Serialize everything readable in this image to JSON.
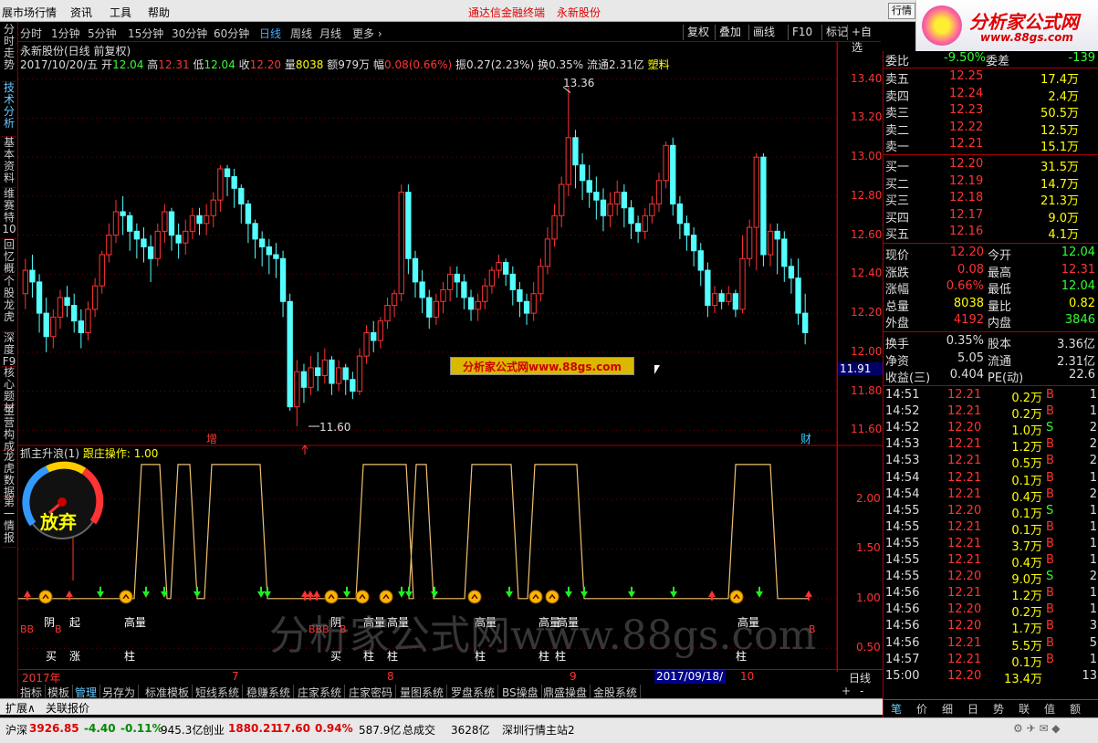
{
  "menubar": {
    "items": [
      "展市场行情",
      "资讯",
      "工具",
      "帮助"
    ],
    "center_left": "通达信金融终端",
    "center_right": "永新股份",
    "btn_hq": "行情"
  },
  "logo": {
    "title": "分析家公式网",
    "url": "www.88gs.com"
  },
  "periods": [
    "分时",
    "1分钟",
    "5分钟",
    "15分钟",
    "30分钟",
    "60分钟",
    "日线",
    "周线",
    "月线",
    "更多 ›"
  ],
  "period_active": "日线",
  "period_right": [
    "复权",
    "叠加",
    "画线",
    "F10",
    "标记",
    "+自选"
  ],
  "lefttabs": [
    "分时走势",
    "技术分析",
    "基本资料",
    "维赛特10",
    "回忆概",
    "个股龙虎",
    "深度F9",
    "核心题材",
    "主营构成",
    "龙虎数据",
    "第一情报"
  ],
  "info": {
    "name": "永新股份(日线 前复权)",
    "date": "2017/10/20/五",
    "open_l": "开",
    "open": "12.04",
    "high_l": "高",
    "high": "12.31",
    "low_l": "低",
    "low": "12.04",
    "close_l": "收",
    "close": "12.20",
    "vol_l": "量",
    "vol": "8038",
    "amt": "额979万",
    "chg_l": "幅",
    "chg": "0.08(0.66%)",
    "amp": "振0.27(2.23%)",
    "turn": "换0.35%",
    "float": "流通2.31亿",
    "ind": "塑料"
  },
  "axis": {
    "main_ticks": [
      "13.40",
      "13.20",
      "13.00",
      "12.80",
      "12.60",
      "12.40",
      "12.20",
      "12.00",
      "11.80",
      "11.60"
    ],
    "cur_price": "11.91",
    "ind_ticks": [
      "2.00",
      "1.50",
      "1.00",
      "0.50"
    ]
  },
  "annotations": {
    "high_label": "13.36",
    "low_label": "11.60",
    "zeng": "增",
    "cai": "财"
  },
  "indicator": {
    "title": "抓主升浪(1)",
    "op_label": "跟庄操作:",
    "op_value": "1.00",
    "gauge_text": "放弃"
  },
  "signals": {
    "row1": [
      "阴",
      "起",
      "高量",
      "阴",
      "高量",
      "高量",
      "高量",
      "高量",
      "高量",
      "高量",
      "高量"
    ],
    "row2": [
      "买",
      "涨",
      "柱",
      "买",
      "柱",
      "柱",
      "柱",
      "柱",
      "柱",
      "柱"
    ],
    "bb": [
      "BB",
      "B",
      "BBB",
      "B",
      "B"
    ]
  },
  "ad_text": "分析家公式网www.88gs.com",
  "watermark": "分析家公式网www.88gs.com",
  "dates": [
    "2017年",
    "7",
    "8",
    "9",
    "10"
  ],
  "date_cursor": "2017/09/18/—",
  "date_right": "日线",
  "bottomtabs": [
    "指标",
    "模板",
    "管理",
    "另存为",
    "标准模板",
    "短线系统",
    "稳赚系统",
    "庄家系统",
    "庄家密码",
    "量图系统",
    "罗盘系统",
    "BS操盘",
    "鼎盛操盘",
    "金股系统"
  ],
  "bottomtabs_active": "管理",
  "ext": {
    "a": "扩展∧",
    "b": "关联报价"
  },
  "status": {
    "sh_label": "沪深",
    "sh": "3926.85",
    "sh_chg": "-4.40",
    "sh_pct": "-0.11%",
    "sh_amt": "945.3亿",
    "cy_label": "创业",
    "cy": "1880.21",
    "cy_chg": "17.60",
    "cy_pct": "0.94%",
    "cy_amt": "587.9亿",
    "total_label": "总成交",
    "total": "3628亿",
    "station": "深圳行情主站2"
  },
  "quote": {
    "weibi": {
      "l": "委比",
      "v": "-9.50%",
      "l2": "委差",
      "v2": "-139"
    },
    "sells": [
      {
        "l": "卖五",
        "p": "12.25",
        "v": "17.4万"
      },
      {
        "l": "卖四",
        "p": "12.24",
        "v": "2.4万"
      },
      {
        "l": "卖三",
        "p": "12.23",
        "v": "50.5万"
      },
      {
        "l": "卖二",
        "p": "12.22",
        "v": "12.5万"
      },
      {
        "l": "卖一",
        "p": "12.21",
        "v": "15.1万"
      }
    ],
    "buys": [
      {
        "l": "买一",
        "p": "12.20",
        "v": "31.5万"
      },
      {
        "l": "买二",
        "p": "12.19",
        "v": "14.7万"
      },
      {
        "l": "买三",
        "p": "12.18",
        "v": "21.3万"
      },
      {
        "l": "买四",
        "p": "12.17",
        "v": "9.0万"
      },
      {
        "l": "买五",
        "p": "12.16",
        "v": "4.1万"
      }
    ],
    "stats": [
      {
        "l": "现价",
        "v": "12.20",
        "l2": "今开",
        "v2": "12.04"
      },
      {
        "l": "涨跌",
        "v": "0.08",
        "l2": "最高",
        "v2": "12.31"
      },
      {
        "l": "涨幅",
        "v": "0.66%",
        "l2": "最低",
        "v2": "12.04"
      },
      {
        "l": "总量",
        "v": "8038",
        "l2": "量比",
        "v2": "0.82"
      },
      {
        "l": "外盘",
        "v": "4192",
        "l2": "内盘",
        "v2": "3846"
      }
    ],
    "stats2": [
      {
        "l": "换手",
        "v": "0.35%",
        "l2": "股本",
        "v2": "3.36亿"
      },
      {
        "l": "净资",
        "v": "5.05",
        "l2": "流通",
        "v2": "2.31亿"
      },
      {
        "l": "收益(三)",
        "v": "0.404",
        "l2": "PE(动)",
        "v2": "22.6"
      }
    ],
    "ticks": [
      {
        "t": "14:51",
        "p": "12.21",
        "v": "0.2万",
        "bs": "B",
        "n": "1"
      },
      {
        "t": "14:52",
        "p": "12.21",
        "v": "0.2万",
        "bs": "B",
        "n": "1"
      },
      {
        "t": "14:52",
        "p": "12.20",
        "v": "1.0万",
        "bs": "S",
        "n": "2"
      },
      {
        "t": "14:53",
        "p": "12.21",
        "v": "1.2万",
        "bs": "B",
        "n": "2"
      },
      {
        "t": "14:53",
        "p": "12.21",
        "v": "0.5万",
        "bs": "B",
        "n": "2"
      },
      {
        "t": "14:54",
        "p": "12.21",
        "v": "0.1万",
        "bs": "B",
        "n": "1"
      },
      {
        "t": "14:54",
        "p": "12.21",
        "v": "0.4万",
        "bs": "B",
        "n": "2"
      },
      {
        "t": "14:55",
        "p": "12.20",
        "v": "0.1万",
        "bs": "S",
        "n": "1"
      },
      {
        "t": "14:55",
        "p": "12.21",
        "v": "0.1万",
        "bs": "B",
        "n": "1"
      },
      {
        "t": "14:55",
        "p": "12.21",
        "v": "3.7万",
        "bs": "B",
        "n": "1"
      },
      {
        "t": "14:55",
        "p": "12.21",
        "v": "0.4万",
        "bs": "B",
        "n": "1"
      },
      {
        "t": "14:55",
        "p": "12.20",
        "v": "9.0万",
        "bs": "S",
        "n": "2"
      },
      {
        "t": "14:56",
        "p": "12.21",
        "v": "1.2万",
        "bs": "B",
        "n": "1"
      },
      {
        "t": "14:56",
        "p": "12.20",
        "v": "0.2万",
        "bs": "B",
        "n": "1"
      },
      {
        "t": "14:56",
        "p": "12.20",
        "v": "1.7万",
        "bs": "B",
        "n": "3"
      },
      {
        "t": "14:56",
        "p": "12.21",
        "v": "5.5万",
        "bs": "B",
        "n": "5"
      },
      {
        "t": "14:57",
        "p": "12.21",
        "v": "0.1万",
        "bs": "B",
        "n": "1"
      },
      {
        "t": "15:00",
        "p": "12.20",
        "v": "13.4万",
        "bs": "",
        "n": "13"
      }
    ],
    "tabs": [
      "笔",
      "价",
      "细",
      "日",
      "势",
      "联",
      "值",
      "额"
    ]
  },
  "chart_data": {
    "type": "candlestick",
    "ylim": [
      11.55,
      13.45
    ],
    "candles": [
      [
        12.3,
        12.42,
        12.22,
        12.48
      ],
      [
        12.42,
        12.36,
        12.28,
        12.5
      ],
      [
        12.36,
        12.2,
        12.1,
        12.4
      ],
      [
        12.2,
        12.08,
        12.0,
        12.28
      ],
      [
        12.08,
        12.18,
        12.02,
        12.22
      ],
      [
        12.18,
        12.28,
        12.12,
        12.32
      ],
      [
        12.28,
        12.24,
        12.18,
        12.34
      ],
      [
        12.24,
        12.16,
        12.1,
        12.3
      ],
      [
        12.16,
        12.1,
        12.02,
        12.22
      ],
      [
        12.1,
        12.22,
        12.06,
        12.26
      ],
      [
        12.22,
        12.34,
        12.18,
        12.38
      ],
      [
        12.34,
        12.5,
        12.3,
        12.52
      ],
      [
        12.5,
        12.6,
        12.46,
        12.66
      ],
      [
        12.6,
        12.72,
        12.56,
        12.78
      ],
      [
        12.72,
        12.7,
        12.6,
        12.8
      ],
      [
        12.7,
        12.62,
        12.52,
        12.72
      ],
      [
        12.62,
        12.58,
        12.48,
        12.66
      ],
      [
        12.58,
        12.54,
        12.46,
        12.64
      ],
      [
        12.54,
        12.48,
        12.36,
        12.6
      ],
      [
        12.48,
        12.62,
        12.44,
        12.66
      ],
      [
        12.62,
        12.72,
        12.56,
        12.76
      ],
      [
        12.72,
        12.6,
        12.52,
        12.74
      ],
      [
        12.6,
        12.56,
        12.48,
        12.66
      ],
      [
        12.56,
        12.62,
        12.5,
        12.68
      ],
      [
        12.62,
        12.7,
        12.58,
        12.74
      ],
      [
        12.7,
        12.66,
        12.6,
        12.74
      ],
      [
        12.66,
        12.7,
        12.6,
        12.76
      ],
      [
        12.7,
        12.78,
        12.64,
        12.82
      ],
      [
        12.78,
        12.94,
        12.72,
        12.96
      ],
      [
        12.94,
        12.9,
        12.8,
        12.96
      ],
      [
        12.9,
        12.84,
        12.74,
        12.94
      ],
      [
        12.84,
        12.76,
        12.66,
        12.86
      ],
      [
        12.76,
        12.66,
        12.56,
        12.78
      ],
      [
        12.66,
        12.58,
        12.48,
        12.68
      ],
      [
        12.58,
        12.54,
        12.44,
        12.62
      ],
      [
        12.54,
        12.5,
        12.4,
        12.58
      ],
      [
        12.5,
        12.48,
        12.38,
        12.56
      ],
      [
        12.48,
        12.26,
        12.18,
        12.52
      ],
      [
        12.26,
        11.72,
        11.7,
        12.3
      ],
      [
        11.72,
        11.9,
        11.62,
        11.96
      ],
      [
        11.9,
        11.82,
        11.74,
        11.94
      ],
      [
        11.82,
        11.92,
        11.78,
        11.98
      ],
      [
        11.92,
        11.88,
        11.8,
        12.0
      ],
      [
        11.88,
        11.96,
        11.84,
        12.02
      ],
      [
        11.96,
        11.84,
        11.78,
        11.98
      ],
      [
        11.84,
        11.92,
        11.8,
        11.96
      ],
      [
        11.92,
        11.86,
        11.78,
        11.94
      ],
      [
        11.86,
        11.8,
        11.76,
        11.9
      ],
      [
        11.8,
        11.98,
        11.78,
        12.02
      ],
      [
        11.98,
        12.1,
        11.94,
        12.14
      ],
      [
        12.1,
        12.06,
        12.0,
        12.16
      ],
      [
        12.06,
        12.16,
        12.02,
        12.18
      ],
      [
        12.16,
        12.24,
        12.12,
        12.28
      ],
      [
        12.24,
        12.3,
        12.18,
        12.32
      ],
      [
        12.3,
        12.82,
        12.26,
        12.86
      ],
      [
        12.82,
        12.48,
        12.4,
        12.86
      ],
      [
        12.48,
        12.36,
        12.28,
        12.52
      ],
      [
        12.36,
        12.28,
        12.2,
        12.42
      ],
      [
        12.28,
        12.18,
        12.12,
        12.32
      ],
      [
        12.18,
        12.26,
        12.14,
        12.3
      ],
      [
        12.26,
        12.32,
        12.2,
        12.36
      ],
      [
        12.32,
        12.4,
        12.26,
        12.44
      ],
      [
        12.4,
        12.36,
        12.28,
        12.44
      ],
      [
        12.36,
        12.28,
        12.22,
        12.4
      ],
      [
        12.28,
        12.22,
        12.16,
        12.32
      ],
      [
        12.22,
        12.26,
        12.16,
        12.3
      ],
      [
        12.26,
        12.34,
        12.22,
        12.38
      ],
      [
        12.34,
        12.42,
        12.3,
        12.44
      ],
      [
        12.42,
        12.46,
        12.38,
        12.5
      ],
      [
        12.46,
        12.4,
        12.34,
        12.48
      ],
      [
        12.4,
        12.32,
        12.24,
        12.44
      ],
      [
        12.32,
        12.26,
        12.18,
        12.36
      ],
      [
        12.26,
        12.2,
        12.14,
        12.3
      ],
      [
        12.2,
        12.3,
        12.16,
        12.36
      ],
      [
        12.3,
        12.44,
        12.26,
        12.48
      ],
      [
        12.44,
        12.58,
        12.4,
        12.64
      ],
      [
        12.58,
        12.7,
        12.54,
        12.76
      ],
      [
        12.7,
        12.86,
        12.64,
        12.9
      ],
      [
        12.86,
        13.1,
        12.8,
        13.36
      ],
      [
        13.1,
        12.96,
        12.84,
        13.14
      ],
      [
        12.96,
        12.88,
        12.78,
        13.02
      ],
      [
        12.88,
        12.82,
        12.74,
        12.96
      ],
      [
        12.82,
        12.78,
        12.68,
        12.9
      ],
      [
        12.78,
        12.7,
        12.62,
        12.84
      ],
      [
        12.7,
        12.76,
        12.64,
        12.82
      ],
      [
        12.76,
        12.82,
        12.7,
        12.88
      ],
      [
        12.82,
        12.74,
        12.64,
        12.86
      ],
      [
        12.74,
        12.66,
        12.58,
        12.78
      ],
      [
        12.66,
        12.62,
        12.56,
        12.7
      ],
      [
        12.62,
        12.7,
        12.58,
        12.74
      ],
      [
        12.7,
        12.76,
        12.66,
        12.8
      ],
      [
        12.76,
        12.88,
        12.72,
        12.92
      ],
      [
        12.88,
        13.06,
        12.84,
        13.08
      ],
      [
        13.06,
        12.76,
        12.7,
        13.1
      ],
      [
        12.76,
        12.66,
        12.58,
        12.8
      ],
      [
        12.66,
        12.6,
        12.52,
        12.7
      ],
      [
        12.6,
        12.52,
        12.44,
        12.64
      ],
      [
        12.52,
        12.42,
        12.34,
        12.56
      ],
      [
        12.42,
        12.24,
        12.18,
        12.46
      ],
      [
        12.24,
        12.3,
        12.2,
        12.34
      ],
      [
        12.3,
        12.26,
        12.22,
        12.32
      ],
      [
        12.26,
        12.3,
        12.24,
        12.34
      ],
      [
        12.3,
        12.22,
        12.18,
        12.32
      ],
      [
        12.22,
        12.48,
        12.2,
        12.6
      ],
      [
        12.48,
        12.64,
        12.44,
        12.68
      ],
      [
        12.64,
        13.0,
        12.42,
        13.02
      ],
      [
        13.0,
        12.5,
        12.44,
        13.02
      ],
      [
        12.5,
        12.62,
        12.44,
        12.66
      ],
      [
        12.62,
        12.58,
        12.4,
        12.66
      ],
      [
        12.58,
        12.44,
        12.36,
        12.62
      ],
      [
        12.44,
        12.38,
        12.3,
        12.48
      ],
      [
        12.38,
        12.2,
        12.14,
        12.48
      ],
      [
        12.2,
        12.1,
        12.04,
        12.3
      ]
    ],
    "indicator": {
      "name": "抓主升浪",
      "ylim": [
        0.3,
        2.45
      ],
      "levels": [
        1.0,
        2.35
      ]
    }
  }
}
